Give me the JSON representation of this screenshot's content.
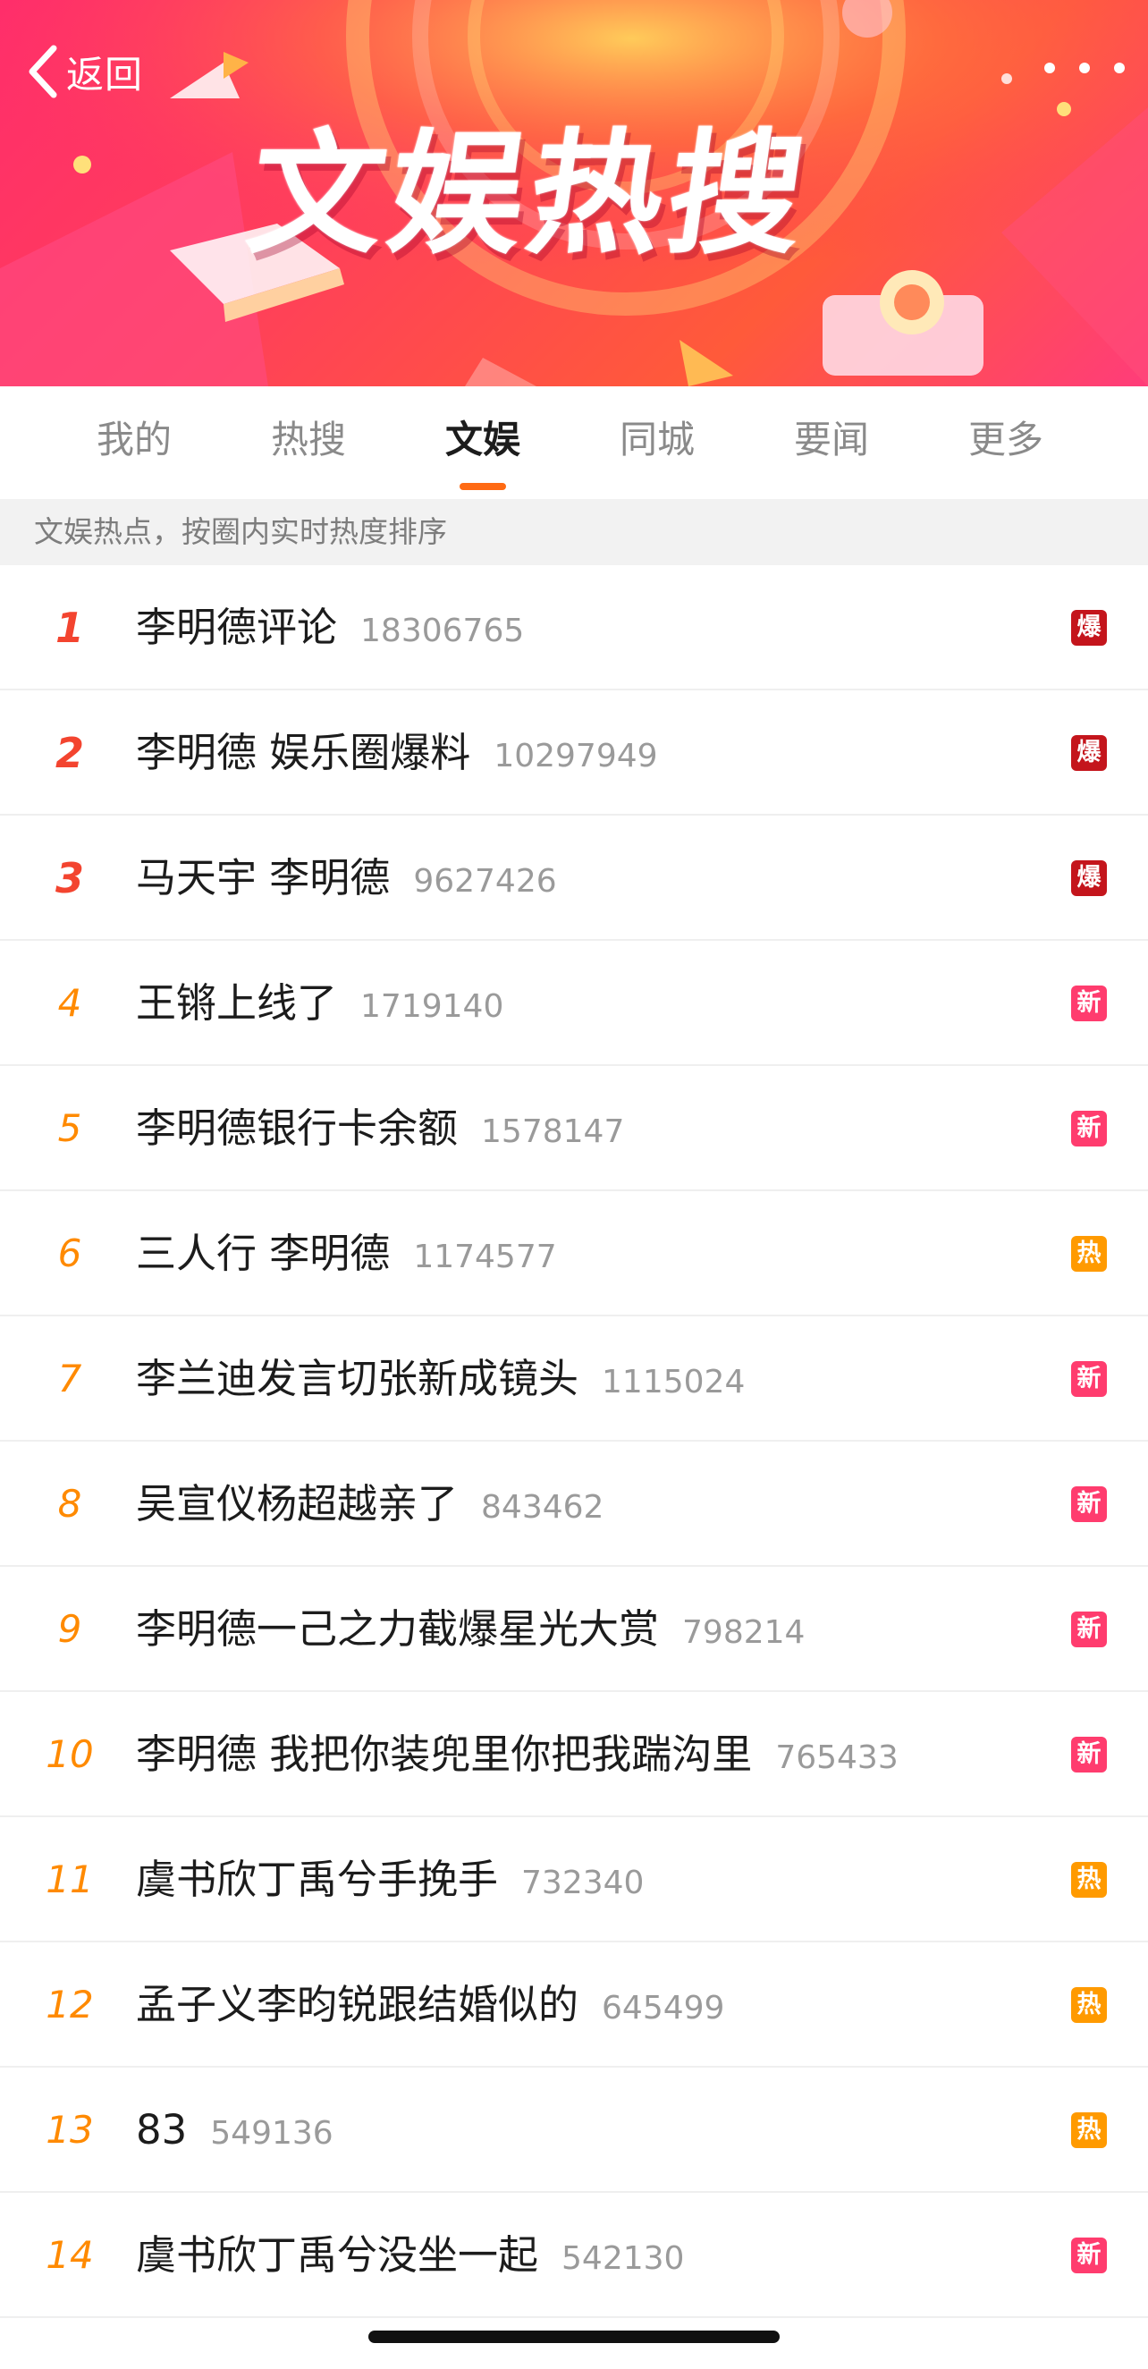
{
  "header": {
    "back_label": "返回",
    "banner_title": "文娱热搜"
  },
  "tabs": [
    {
      "label": "我的",
      "active": false
    },
    {
      "label": "热搜",
      "active": false
    },
    {
      "label": "文娱",
      "active": true
    },
    {
      "label": "同城",
      "active": false
    },
    {
      "label": "要闻",
      "active": false
    },
    {
      "label": "更多",
      "active": false
    }
  ],
  "subheader": "文娱热点，按圈内实时热度排序",
  "colors": {
    "accent": "#ff6a13",
    "rank_top": "#f3442f",
    "rank_other": "#ff8a00",
    "badge_bao": "#c4151c",
    "badge_xin": "#ff3c6e",
    "badge_re": "#ff9a00"
  },
  "items": [
    {
      "rank": "1",
      "title": "李明德评论",
      "count": "18306765",
      "badge": "爆",
      "badge_type": "bao"
    },
    {
      "rank": "2",
      "title": "李明德 娱乐圈爆料",
      "count": "10297949",
      "badge": "爆",
      "badge_type": "bao"
    },
    {
      "rank": "3",
      "title": "马天宇 李明德",
      "count": "9627426",
      "badge": "爆",
      "badge_type": "bao"
    },
    {
      "rank": "4",
      "title": "王锵上线了",
      "count": "1719140",
      "badge": "新",
      "badge_type": "xin"
    },
    {
      "rank": "5",
      "title": "李明德银行卡余额",
      "count": "1578147",
      "badge": "新",
      "badge_type": "xin"
    },
    {
      "rank": "6",
      "title": "三人行 李明德",
      "count": "1174577",
      "badge": "热",
      "badge_type": "re"
    },
    {
      "rank": "7",
      "title": "李兰迪发言切张新成镜头",
      "count": "1115024",
      "badge": "新",
      "badge_type": "xin"
    },
    {
      "rank": "8",
      "title": "吴宣仪杨超越亲了",
      "count": "843462",
      "badge": "新",
      "badge_type": "xin"
    },
    {
      "rank": "9",
      "title": "李明德一己之力截爆星光大赏",
      "count": "798214",
      "badge": "新",
      "badge_type": "xin"
    },
    {
      "rank": "10",
      "title": "李明德 我把你装兜里你把我踹沟里",
      "count": "765433",
      "badge": "新",
      "badge_type": "xin"
    },
    {
      "rank": "11",
      "title": "虞书欣丁禹兮手挽手",
      "count": "732340",
      "badge": "热",
      "badge_type": "re"
    },
    {
      "rank": "12",
      "title": "孟子义李昀锐跟结婚似的",
      "count": "645499",
      "badge": "热",
      "badge_type": "re"
    },
    {
      "rank": "13",
      "title": "83",
      "count": "549136",
      "badge": "热",
      "badge_type": "re"
    },
    {
      "rank": "14",
      "title": "虞书欣丁禹兮没坐一起",
      "count": "542130",
      "badge": "新",
      "badge_type": "xin"
    }
  ]
}
